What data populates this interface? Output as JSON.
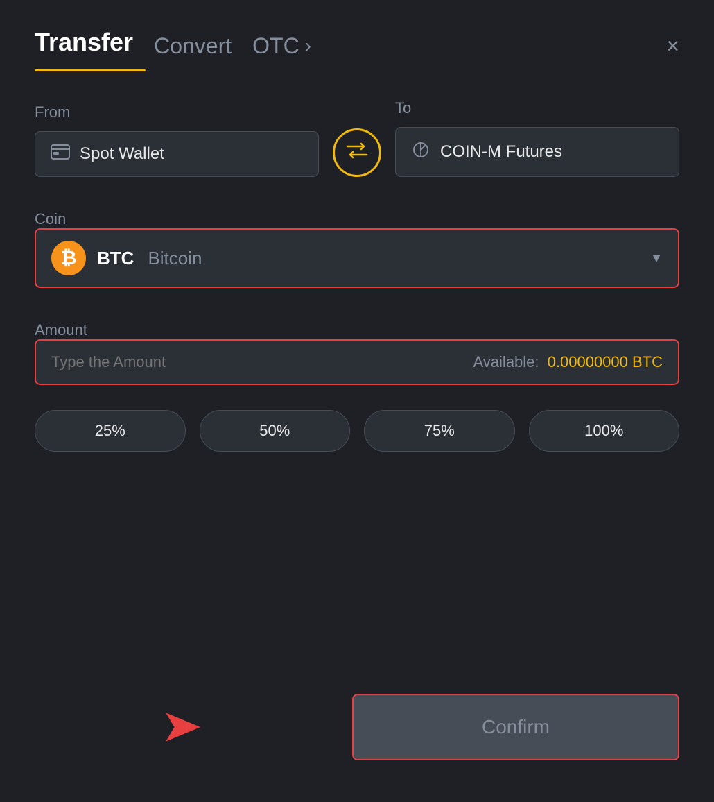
{
  "header": {
    "tab_transfer": "Transfer",
    "tab_convert": "Convert",
    "tab_otc": "OTC",
    "tab_otc_chevron": "›",
    "close_label": "×"
  },
  "from_section": {
    "label": "From",
    "wallet_name": "Spot Wallet"
  },
  "to_section": {
    "label": "To",
    "wallet_name": "COIN-M Futures"
  },
  "swap": {
    "icon": "⇄"
  },
  "coin_section": {
    "label": "Coin",
    "coin_symbol": "BTC",
    "coin_fullname": "Bitcoin",
    "chevron": "▼"
  },
  "amount_section": {
    "label": "Amount",
    "placeholder": "Type the Amount",
    "available_label": "Available:",
    "available_value": "0.00000000 BTC"
  },
  "percent_buttons": [
    {
      "label": "25%"
    },
    {
      "label": "50%"
    },
    {
      "label": "75%"
    },
    {
      "label": "100%"
    }
  ],
  "confirm_button": {
    "label": "Confirm"
  },
  "colors": {
    "accent_gold": "#f0b90b",
    "accent_red": "#e84040",
    "bg_dark": "#1e2026",
    "bg_card": "#2b2f36",
    "text_muted": "#848e9c",
    "text_light": "#e8e8e8"
  }
}
